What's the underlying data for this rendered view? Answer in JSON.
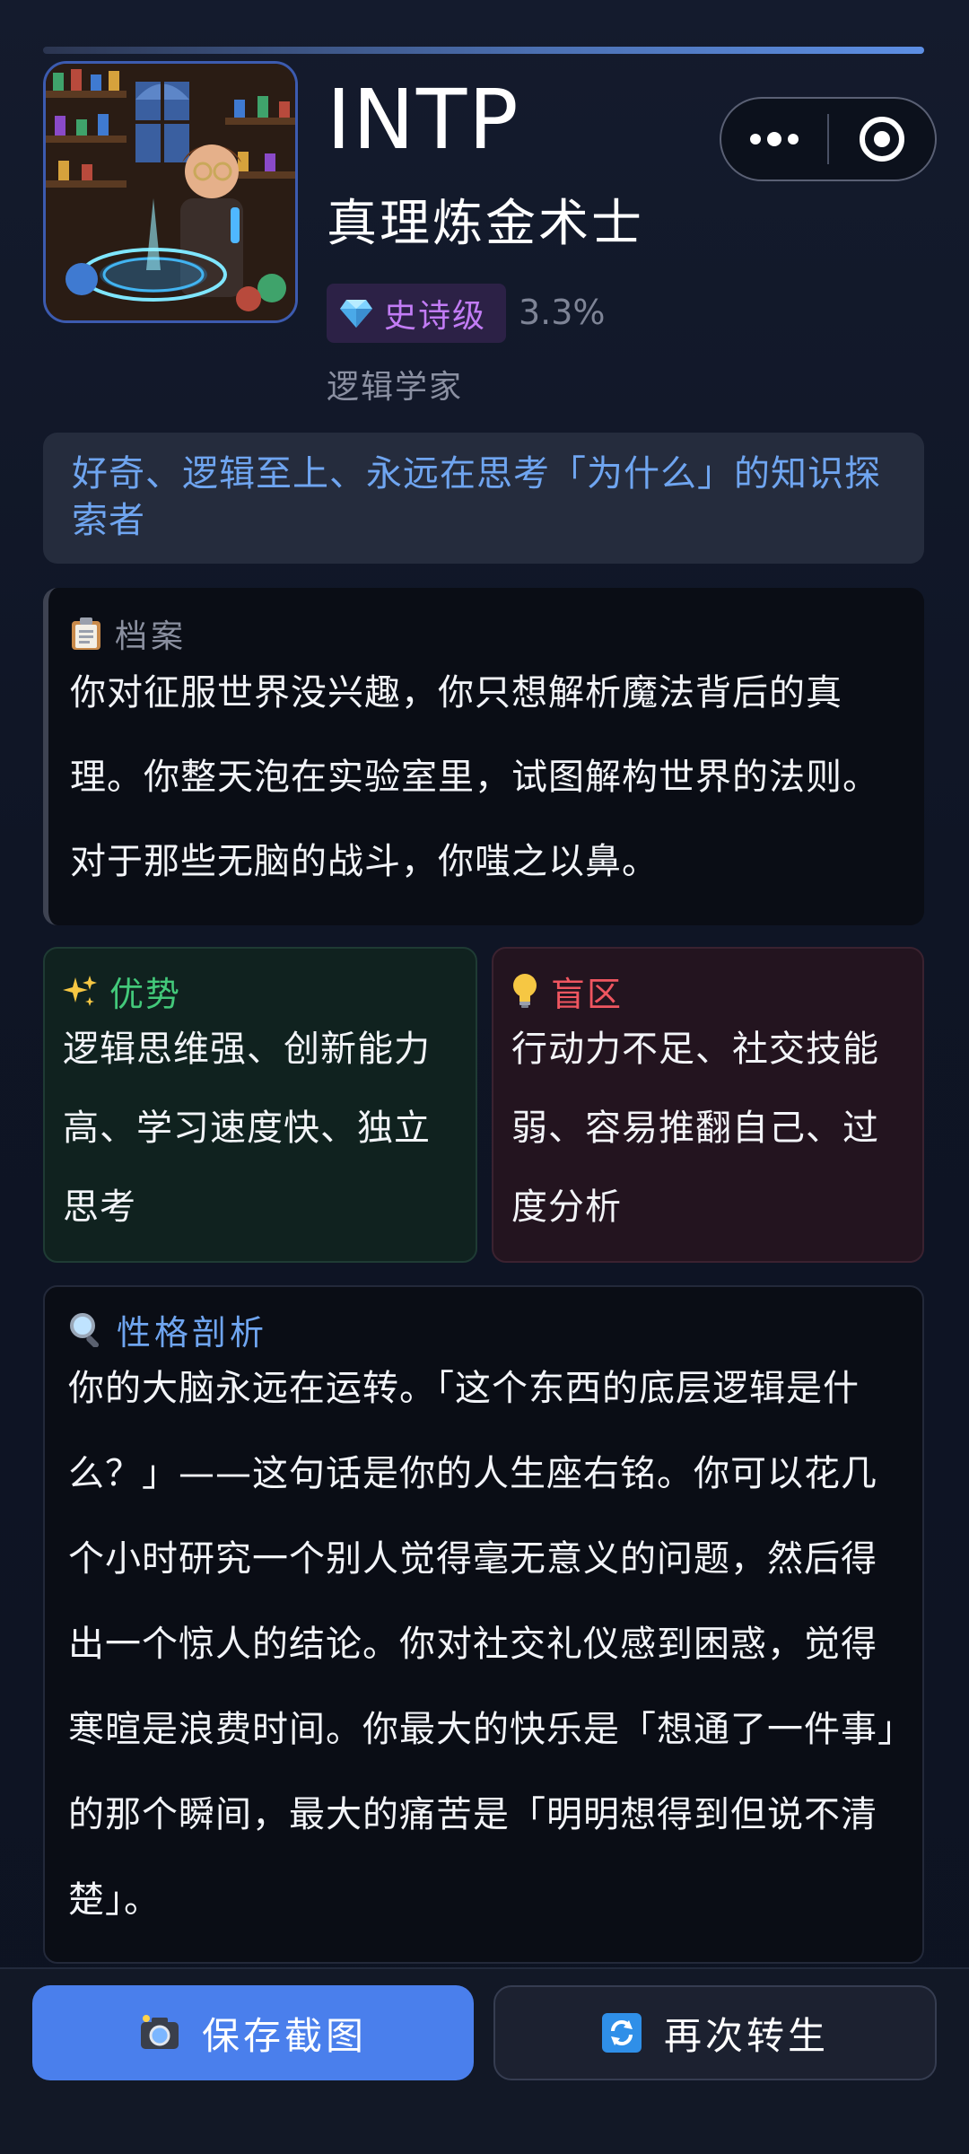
{
  "header": {
    "type_code": "INTP",
    "type_title": "真理炼金术士",
    "rarity_label": "史诗级",
    "rarity_percent": "3.3%",
    "role": "逻辑学家"
  },
  "tagline": "好奇、逻辑至上、永远在思考「为什么」的知识探索者",
  "dossier": {
    "label": "档案",
    "body": "你对征服世界没兴趣，你只想解析魔法背后的真理。你整天泡在实验室里，试图解构世界的法则。对于那些无脑的战斗，你嗤之以鼻。"
  },
  "strengths": {
    "label": "优势",
    "body": "逻辑思维强、创新能力高、学习速度快、独立思考"
  },
  "blindspots": {
    "label": "盲区",
    "body": "行动力不足、社交技能弱、容易推翻自己、过度分析"
  },
  "analysis": {
    "label": "性格剖析",
    "body": "你的大脑永远在运转。「这个东西的底层逻辑是什么？」——这句话是你的人生座右铭。你可以花几个小时研究一个别人觉得毫无意义的问题，然后得出一个惊人的结论。你对社交礼仪感到困惑，觉得寒暄是浪费时间。你最大的快乐是「想通了一件事」的那个瞬间，最大的痛苦是「明明想得到但说不清楚」。"
  },
  "actions": {
    "save_label": "保存截图",
    "reborn_label": "再次转生"
  },
  "icons": {
    "rarity": "diamond-icon",
    "dossier": "clipboard-icon",
    "strengths": "sparkles-icon",
    "blindspots": "lightbulb-icon",
    "analysis": "magnifier-icon",
    "save": "camera-icon",
    "reborn": "refresh-icon",
    "capsule_more": "more-dots-icon",
    "capsule_close": "target-icon"
  },
  "colors": {
    "accent_blue": "#4a7fec",
    "epic_purple": "#c27cf5",
    "strength_green": "#43c97a",
    "blind_red": "#f05660",
    "tagline_blue": "#6fa5f0"
  }
}
